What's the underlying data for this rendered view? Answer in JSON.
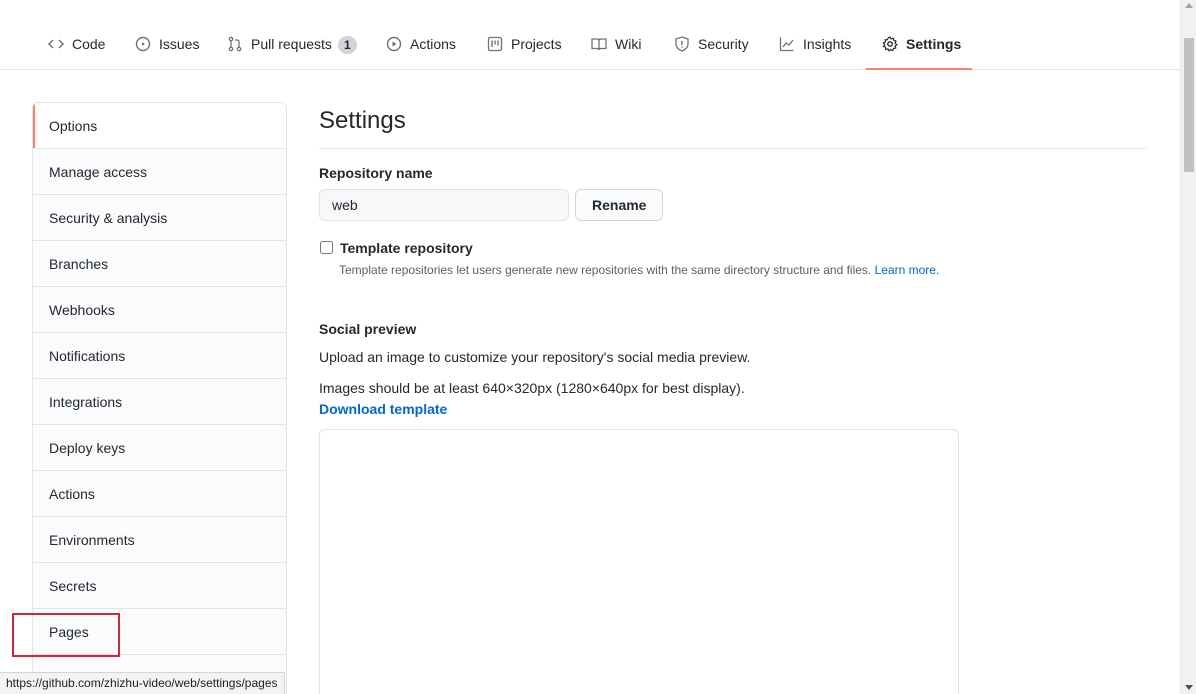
{
  "nav": {
    "tabs": [
      {
        "label": "Code",
        "icon": "code-icon"
      },
      {
        "label": "Issues",
        "icon": "issue-icon"
      },
      {
        "label": "Pull requests",
        "icon": "pull-request-icon",
        "count": "1"
      },
      {
        "label": "Actions",
        "icon": "play-icon"
      },
      {
        "label": "Projects",
        "icon": "project-icon"
      },
      {
        "label": "Wiki",
        "icon": "book-icon"
      },
      {
        "label": "Security",
        "icon": "shield-icon"
      },
      {
        "label": "Insights",
        "icon": "graph-icon"
      },
      {
        "label": "Settings",
        "icon": "gear-icon",
        "selected": true
      }
    ]
  },
  "sidebar": {
    "items": [
      {
        "label": "Options",
        "selected": true
      },
      {
        "label": "Manage access"
      },
      {
        "label": "Security & analysis"
      },
      {
        "label": "Branches"
      },
      {
        "label": "Webhooks"
      },
      {
        "label": "Notifications"
      },
      {
        "label": "Integrations"
      },
      {
        "label": "Deploy keys"
      },
      {
        "label": "Actions"
      },
      {
        "label": "Environments"
      },
      {
        "label": "Secrets"
      },
      {
        "label": "Pages"
      }
    ]
  },
  "main": {
    "title": "Settings",
    "repo_name_label": "Repository name",
    "repo_name_value": "web",
    "rename_label": "Rename",
    "template_label": "Template repository",
    "template_note": "Template repositories let users generate new repositories with the same directory structure and files.",
    "learn_more": "Learn more.",
    "social_label": "Social preview",
    "social_desc": "Upload an image to customize your repository's social media preview.",
    "image_hint": "Images should be at least 640×320px (1280×640px for best display).",
    "download_template": "Download template"
  },
  "status_url": "https://github.com/zhizhu-video/web/settings/pages",
  "colors": {
    "accent": "#f9826c",
    "link": "#0366d6",
    "highlight": "#cc2a36"
  }
}
